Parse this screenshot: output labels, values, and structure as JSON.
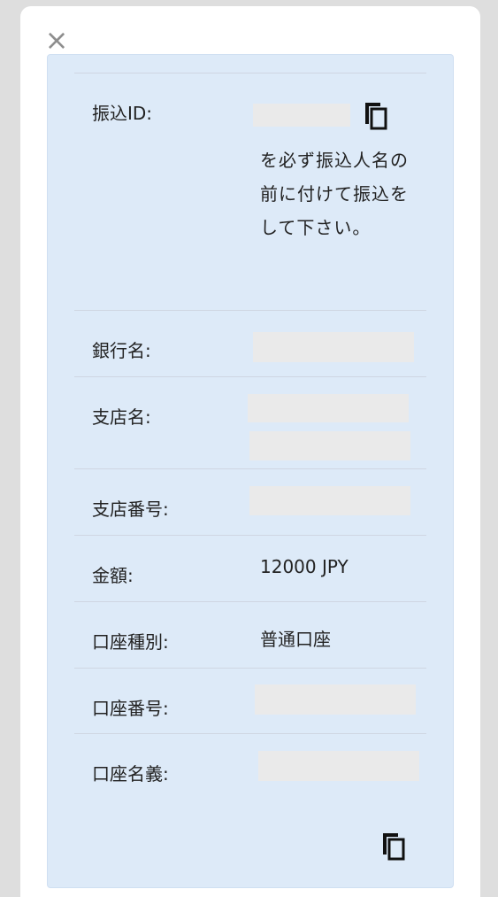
{
  "dialog": {
    "close_icon": "close-icon",
    "copy_icon": "copy-icon"
  },
  "rows": {
    "transfer_id": {
      "label": "振込ID:",
      "note": "を必ず振込人名の前に付けて振込をして下さい。"
    },
    "bank_name": {
      "label": "銀行名:"
    },
    "branch_name": {
      "label": "支店名:"
    },
    "branch_number": {
      "label": "支店番号:"
    },
    "amount": {
      "label": "金額:",
      "value": "12000 JPY"
    },
    "account_type": {
      "label": "口座種別:",
      "value": "普通口座"
    },
    "account_number": {
      "label": "口座番号:"
    },
    "account_holder": {
      "label": "口座名義:"
    }
  }
}
